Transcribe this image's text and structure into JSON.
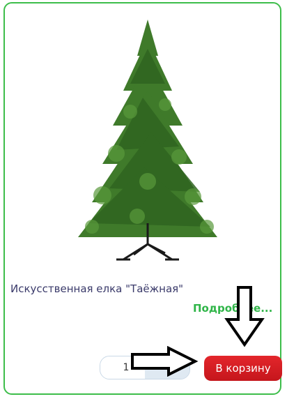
{
  "product": {
    "title": "Искусственная елка \"Таёжная\"",
    "details_link": "Подробнее...",
    "quantity": "1",
    "cart_button": "В корзину",
    "image_icon": "christmas-tree-image"
  },
  "colors": {
    "card_border": "#3dbd4a",
    "link": "#2fb548",
    "button": "#d61e24"
  }
}
